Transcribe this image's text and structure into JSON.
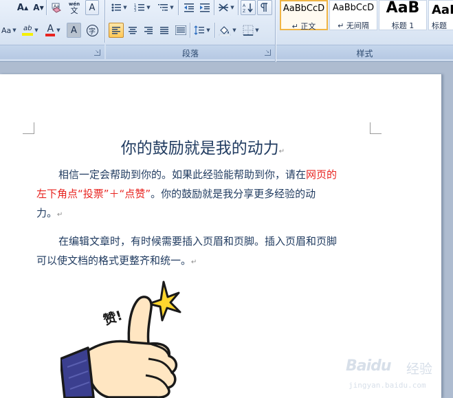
{
  "ribbon": {
    "paragraph_group": {
      "label": "段落"
    },
    "styles_group": {
      "label": "样式"
    },
    "font": {
      "grow_font_icon": "A",
      "shrink_font_icon": "A",
      "change_case_label": "Aa",
      "highlight_label": "ab",
      "font_color_label": "A",
      "char_shading_label": "A",
      "enclose_char_label": "字",
      "phonetic_label": "wén",
      "phonetic_char": "文",
      "border_char_label": "A"
    },
    "colors": {
      "highlight": "#f5f000",
      "font_color": "#e8231f",
      "active_border": "#c28a30"
    },
    "styles": [
      {
        "sample": "AaBbCcD",
        "name": "↵ 正文",
        "selected": true
      },
      {
        "sample": "AaBbCcD",
        "name": "↵ 无间隔",
        "selected": false
      },
      {
        "sample": "AaB",
        "name": "标题 1",
        "selected": false
      },
      {
        "sample": "AaI",
        "name": "标题",
        "selected": false
      }
    ]
  },
  "document": {
    "title": "你的鼓励就是我的动力",
    "paragraph1": {
      "line1_a": "相信一定会帮助到你的。如果此经验能帮助到你，请在",
      "line1_b": "网页的",
      "line2_a": "左下角点“投票”＋“点赞”",
      "line2_b": "。你的鼓励就是我分享更多经验的动",
      "line3": "力。"
    },
    "paragraph2": {
      "line1": "在编辑文章时，有时候需要插入页眉和页脚。插入页眉和页脚",
      "line2": "可以使文档的格式更整齐和统一。"
    },
    "paragraph_mark": "↵",
    "image": {
      "caption_text": "赞!",
      "icon": "thumbs-up-icon"
    }
  },
  "watermark": {
    "brand": "Baidu",
    "cn": "经验",
    "url": "jingyan.baidu.com"
  }
}
